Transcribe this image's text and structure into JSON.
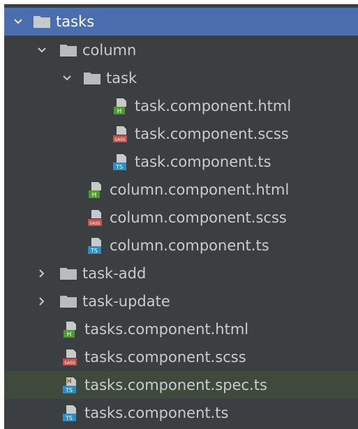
{
  "tree": {
    "root": {
      "label": "tasks"
    },
    "column": {
      "label": "column"
    },
    "task": {
      "label": "task"
    },
    "task_files": [
      {
        "label": "task.component.html",
        "icon": "html-file-icon"
      },
      {
        "label": "task.component.scss",
        "icon": "sass-file-icon"
      },
      {
        "label": "task.component.ts",
        "icon": "typescript-file-icon"
      }
    ],
    "column_files": [
      {
        "label": "column.component.html",
        "icon": "html-file-icon"
      },
      {
        "label": "column.component.scss",
        "icon": "sass-file-icon"
      },
      {
        "label": "column.component.ts",
        "icon": "typescript-file-icon"
      }
    ],
    "task_add": {
      "label": "task-add"
    },
    "task_update": {
      "label": "task-update"
    },
    "tasks_files": [
      {
        "label": "tasks.component.html",
        "icon": "html-file-icon"
      },
      {
        "label": "tasks.component.scss",
        "icon": "sass-file-icon"
      },
      {
        "label": "tasks.component.spec.ts",
        "icon": "typescript-test-file-icon"
      },
      {
        "label": "tasks.component.ts",
        "icon": "typescript-file-icon"
      }
    ]
  },
  "colors": {
    "background": "#3c3f41",
    "selection": "#4b6eaf",
    "highlight_row": "#3f4a3c",
    "folder": "#b8bcbf",
    "html_badge": "#4e9a2f",
    "sass_badge": "#c6504b",
    "ts_badge": "#2d8ec4",
    "text": "#c9ccce"
  },
  "icon_badges": {
    "html": "H",
    "sass": "SASS",
    "ts": "TS"
  }
}
